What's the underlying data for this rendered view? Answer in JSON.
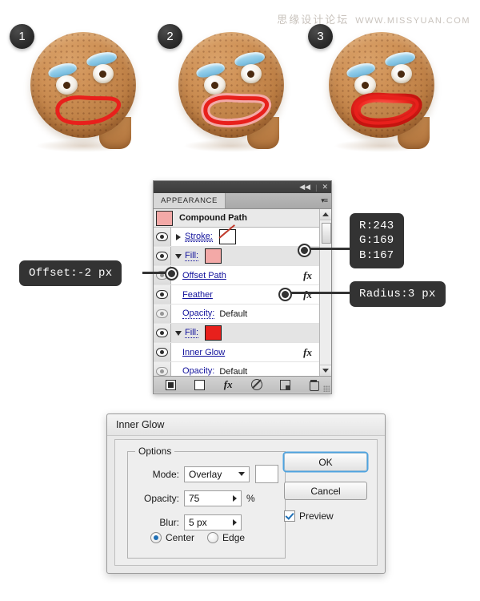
{
  "watermark": {
    "cn": "思缘设计论坛",
    "en": "WWW.MISSYUAN.COM"
  },
  "steps": [
    {
      "number": "1"
    },
    {
      "number": "2"
    },
    {
      "number": "3"
    }
  ],
  "panel": {
    "titlebar": {
      "collapse_icon": "◀◀",
      "separator": "|",
      "close_icon": "✕"
    },
    "tab_label": "APPEARANCE",
    "menu_icon": "▾≡",
    "header_row": {
      "title": "Compound Path"
    },
    "rows": [
      {
        "label": "Stroke:",
        "value": "",
        "swatch": "none"
      },
      {
        "label": "Fill:",
        "value": "",
        "swatch": "pink"
      },
      {
        "label": "Offset Path",
        "value": "",
        "fx": "fx"
      },
      {
        "label": "Feather",
        "value": "",
        "fx": "fx"
      },
      {
        "label": "Opacity:",
        "value": "Default"
      },
      {
        "label": "Fill:",
        "value": "",
        "swatch": "red"
      },
      {
        "label": "Inner Glow",
        "value": "",
        "fx": "fx"
      },
      {
        "label": "Opacity:",
        "value": "Default"
      }
    ],
    "footer_icons": [
      "add-new-stroke-icon",
      "add-new-fill-icon",
      "add-new-effect-icon",
      "clear-appearance-icon",
      "duplicate-item-icon",
      "delete-item-icon"
    ]
  },
  "callouts": {
    "offset": "Offset:-2 px",
    "rgb": "R:243\nG:169\nB:167",
    "radius": "Radius:3 px"
  },
  "dialog": {
    "title": "Inner Glow",
    "group_legend": "Options",
    "mode_label": "Mode:",
    "mode_value": "Overlay",
    "opacity_label": "Opacity:",
    "opacity_value": "75",
    "opacity_unit": "%",
    "blur_label": "Blur:",
    "blur_value": "5 px",
    "center_label": "Center",
    "edge_label": "Edge",
    "ok_label": "OK",
    "cancel_label": "Cancel",
    "preview_label": "Preview"
  },
  "colors": {
    "fill_pink": "#f3a9a7",
    "fill_red": "#e8201c",
    "callout_bg": "#333333",
    "accent_blue": "#1f6fb5"
  }
}
